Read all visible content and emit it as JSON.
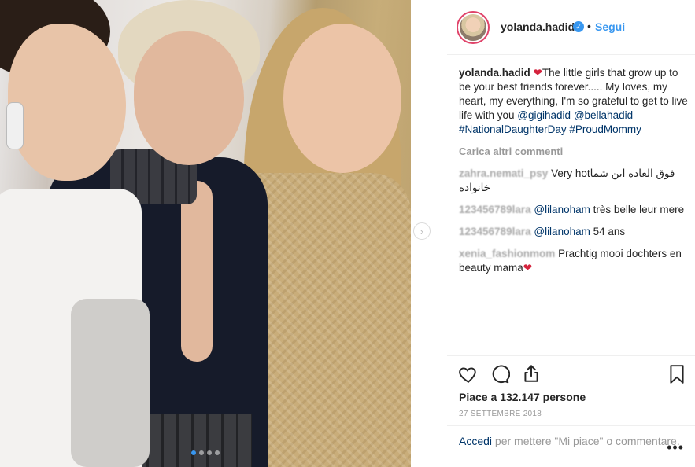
{
  "header": {
    "username": "yolanda.hadid",
    "separator": "•",
    "follow_label": "Segui"
  },
  "caption": {
    "username": "yolanda.hadid",
    "emoji": "❤",
    "text_1": "The little girls that grow up to be your best friends forever..... My loves, my heart, my everything, I'm so grateful to get to live life with you ",
    "mention_1": "@gigihadid",
    "mention_2": "@bellahadid",
    "hashtag_1": "#NationalDaughterDay",
    "hashtag_2": "#ProudMommy"
  },
  "load_more_label": "Carica altri commenti",
  "comments": [
    {
      "user": "zahra.nemati_psy",
      "text": "Very hotفوق العاده این شما خانواده"
    },
    {
      "user": "123456789lara",
      "mention": "@lilanoham",
      "text": "très belle leur mere"
    },
    {
      "user": "123456789lara",
      "mention": "@lilanoham",
      "text": "54 ans"
    },
    {
      "user": "xenia_fashionmom",
      "text": "Prachtig mooi dochters en beauty mama",
      "emoji": "❤"
    }
  ],
  "likes_label": "Piace a 132.147 persone",
  "date_label": "27 SETTEMBRE 2018",
  "login_prompt": {
    "link": "Accedi",
    "text": " per mettere \"Mi piace\" o commentare."
  },
  "more_options": "•••",
  "carousel": {
    "total": 4,
    "active_index": 0
  },
  "colors": {
    "link_blue": "#3897f0",
    "mention_navy": "#003569",
    "heart_red": "#d4233d"
  }
}
